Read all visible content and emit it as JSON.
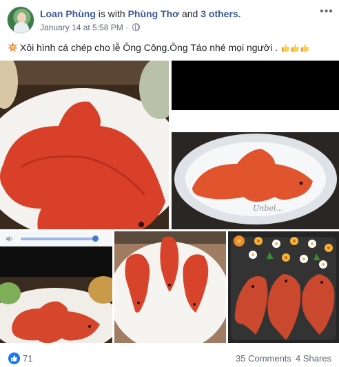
{
  "post": {
    "author": "Loan Phùng",
    "with_text": "is with",
    "tagged_person": "Phùng Thơ",
    "and_text": "and",
    "others_link": "3 others.",
    "timestamp": "January 14 at 5:58 PM",
    "separator": "·",
    "privacy_icon": "globe-icon",
    "more_icon": "more-options-icon",
    "caption_text": "Xôi hình cá chép cho lễ Ông Công.Ông Táo nhé mọi người . ",
    "caption_emoji": [
      "burst-icon",
      "thumbs-up-icon",
      "thumbs-up-icon",
      "thumbs-up-icon"
    ],
    "photo_watermark": "Unbel..."
  },
  "colors": {
    "link": "#385898",
    "text": "#1c1e21",
    "muted": "#616770",
    "like_blue": "#1877f2",
    "carp_red": "#d9432a"
  },
  "audio_player": {
    "icon": "speaker-icon",
    "progress": 0.96
  },
  "footer": {
    "reactions_icon": "like-icon",
    "reactions_count": "71",
    "comments_label": "35 Comments",
    "shares_label": "4 Shares"
  }
}
